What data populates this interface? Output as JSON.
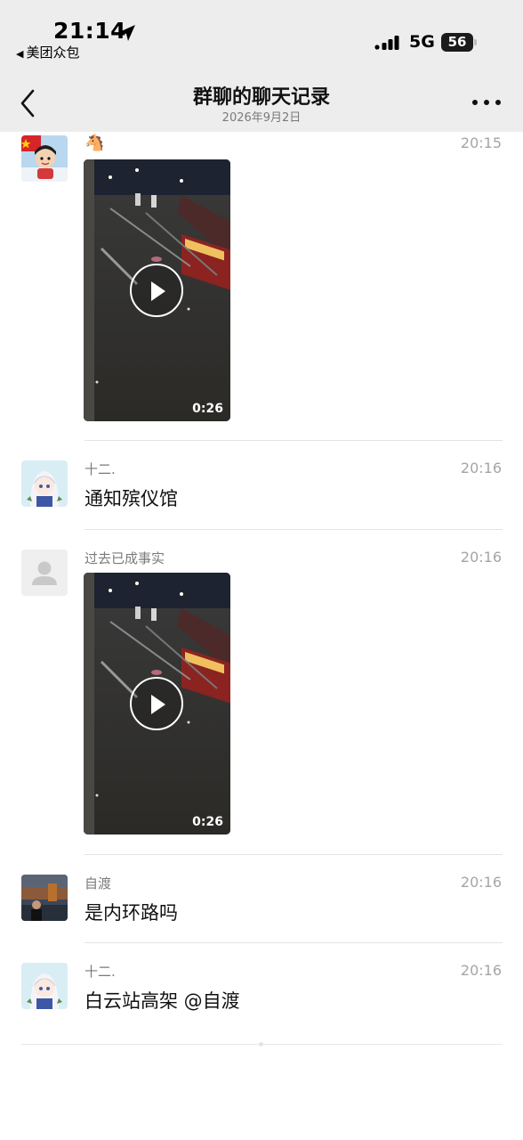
{
  "status_bar": {
    "time": "21:14",
    "back_app": "美团众包",
    "network": "5G",
    "battery": "56"
  },
  "nav": {
    "title": "群聊的聊天记录",
    "subtitle": "2026年9月2日"
  },
  "messages": [
    {
      "sender": "🐴",
      "time": "20:15",
      "type": "video",
      "duration": "0:26"
    },
    {
      "sender": "十二.",
      "time": "20:16",
      "type": "text",
      "text": "通知殡仪馆"
    },
    {
      "sender": "过去已成事实",
      "time": "20:16",
      "type": "video",
      "duration": "0:26"
    },
    {
      "sender": "自渡",
      "time": "20:16",
      "type": "text",
      "text": "是内环路吗"
    },
    {
      "sender": "十二.",
      "time": "20:16",
      "type": "text",
      "text": "白云站高架 @自渡"
    }
  ],
  "colors": {
    "header_bg": "#ededed",
    "timestamp": "#a5a5a5",
    "sender": "#7a7a7a"
  }
}
